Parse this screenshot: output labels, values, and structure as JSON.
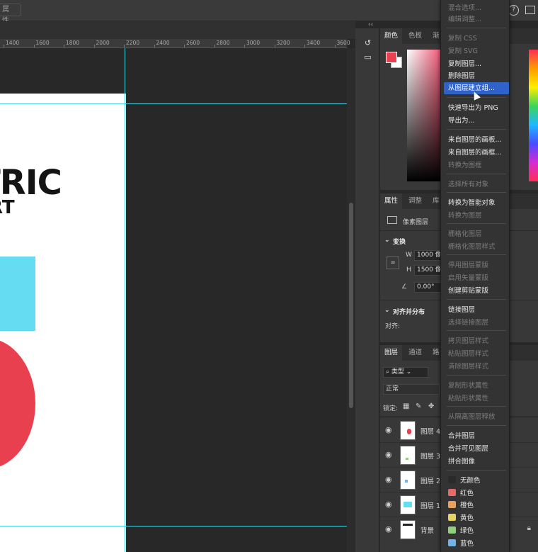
{
  "toolbar": {
    "field_fragment": "属性..."
  },
  "ruler": {
    "ticks": [
      "1400",
      "1600",
      "1800",
      "2000",
      "2200",
      "2400",
      "2600",
      "2800",
      "3000",
      "3200",
      "3400",
      "3600"
    ]
  },
  "artboard": {
    "title": "TRIC",
    "subtitle": "RT",
    "colors": {
      "rect": "#66dcf3",
      "circle": "#e9404f",
      "guide": "#4ad1e0"
    }
  },
  "color_panel": {
    "tabs": [
      "颜色",
      "色板",
      "渐"
    ],
    "foreground": "#e9404f",
    "background": "#ffffff"
  },
  "properties_panel": {
    "tabs": [
      "属性",
      "调整",
      "库"
    ],
    "layer_type": "像素图层",
    "transform_label": "变换",
    "w_label": "W",
    "w_value": "1000 像",
    "h_label": "H",
    "h_value": "1500 像",
    "angle_value": "0.00°",
    "align_label": "对齐并分布",
    "align_sub": "对齐:"
  },
  "layers_panel": {
    "tabs": [
      "图层",
      "通道",
      "路"
    ],
    "filter": "类型",
    "blend_mode": "正常",
    "lock_label": "锁定:",
    "layers": [
      {
        "name": "图层 4"
      },
      {
        "name": "图层 3"
      },
      {
        "name": "图层 2"
      },
      {
        "name": "图层 1"
      },
      {
        "name": "背景"
      }
    ]
  },
  "context_menu": {
    "items": [
      {
        "label": "混合选项...",
        "enabled": false
      },
      {
        "label": "编辑调整...",
        "enabled": false
      },
      {
        "label": "复制 CSS",
        "enabled": false
      },
      {
        "label": "复制 SVG",
        "enabled": false
      },
      {
        "label": "复制图层...",
        "enabled": true
      },
      {
        "label": "删除图层",
        "enabled": true
      },
      {
        "label": "从图层建立组...",
        "enabled": true,
        "highlighted": true
      },
      {
        "label": "快速导出为 PNG",
        "enabled": true
      },
      {
        "label": "导出为...",
        "enabled": true
      },
      {
        "label": "来自图层的画板...",
        "enabled": true
      },
      {
        "label": "来自图层的画框...",
        "enabled": true
      },
      {
        "label": "转换为图框",
        "enabled": false
      },
      {
        "label": "选择所有对象",
        "enabled": false
      },
      {
        "label": "转换为智能对象",
        "enabled": true
      },
      {
        "label": "转换为图层",
        "enabled": false
      },
      {
        "label": "栅格化图层",
        "enabled": false
      },
      {
        "label": "栅格化图层样式",
        "enabled": false
      },
      {
        "label": "停用图层蒙版",
        "enabled": false
      },
      {
        "label": "启用矢量蒙版",
        "enabled": false
      },
      {
        "label": "创建剪贴蒙版",
        "enabled": true
      },
      {
        "label": "链接图层",
        "enabled": true
      },
      {
        "label": "选择链接图层",
        "enabled": false
      },
      {
        "label": "拷贝图层样式",
        "enabled": false
      },
      {
        "label": "粘贴图层样式",
        "enabled": false
      },
      {
        "label": "清除图层样式",
        "enabled": false
      },
      {
        "label": "复制形状属性",
        "enabled": false
      },
      {
        "label": "粘贴形状属性",
        "enabled": false
      },
      {
        "label": "从隔离图层释放",
        "enabled": false
      },
      {
        "label": "合并图层",
        "enabled": true
      },
      {
        "label": "合并可见图层",
        "enabled": true
      },
      {
        "label": "拼合图像",
        "enabled": true
      },
      {
        "label": "无颜色",
        "enabled": true,
        "color": "#2a2a2a"
      },
      {
        "label": "红色",
        "enabled": true,
        "color": "#e56b6b"
      },
      {
        "label": "橙色",
        "enabled": true,
        "color": "#e8a25c"
      },
      {
        "label": "黄色",
        "enabled": true,
        "color": "#e5d45f"
      },
      {
        "label": "绿色",
        "enabled": true,
        "color": "#8fd07a"
      },
      {
        "label": "蓝色",
        "enabled": true,
        "color": "#6fb3e8"
      }
    ]
  }
}
